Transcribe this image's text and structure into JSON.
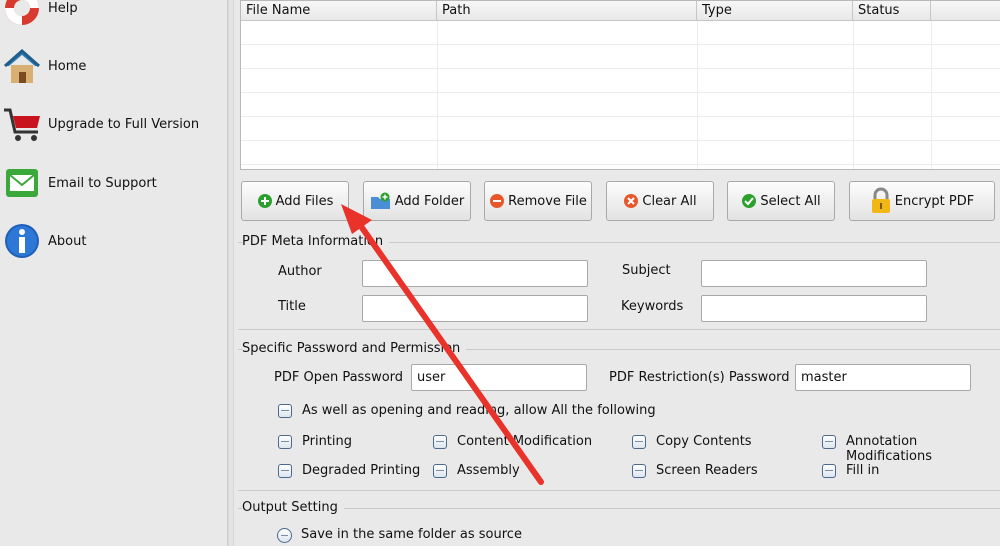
{
  "sidebar": {
    "items": [
      {
        "label": "Help",
        "icon": "help-lifebuoy-icon"
      },
      {
        "label": "Home",
        "icon": "home-icon"
      },
      {
        "label": "Upgrade to Full Version",
        "icon": "shopping-cart-icon"
      },
      {
        "label": "Email to Support",
        "icon": "email-icon"
      },
      {
        "label": "About",
        "icon": "info-icon"
      }
    ]
  },
  "file_table": {
    "columns": [
      "File Name",
      "Path",
      "Type",
      "Status"
    ]
  },
  "toolbar": {
    "add_files": "Add Files",
    "add_folder": "Add Folder",
    "remove_file": "Remove File",
    "clear_all": "Clear All",
    "select_all": "Select All",
    "encrypt_pdf": "Encrypt PDF"
  },
  "meta": {
    "title": "PDF Meta Information",
    "author_label": "Author",
    "author_value": "",
    "subject_label": "Subject",
    "subject_value": "",
    "title_label": "Title",
    "title_value": "",
    "keywords_label": "Keywords",
    "keywords_value": ""
  },
  "password": {
    "title": "Specific Password and Permission",
    "open_label": "PDF Open Password",
    "open_value": "user",
    "restriction_label": "PDF Restriction(s) Password",
    "restriction_value": "master",
    "allow_all": "As well as opening and reading, allow All the following",
    "permissions": [
      "Printing",
      "Content Modification",
      "Copy Contents",
      "Annotation Modifications",
      "Degraded Printing",
      "Assembly",
      "Screen Readers",
      "Fill in"
    ]
  },
  "output": {
    "title": "Output Setting",
    "same_folder": "Save in the same folder as source"
  },
  "colors": {
    "annotation_arrow": "#e8322a"
  }
}
